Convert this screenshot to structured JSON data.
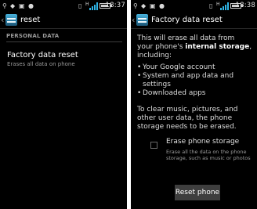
{
  "left": {
    "status": {
      "time": "18:37",
      "signal_label": "H"
    },
    "actionbar": {
      "title": "reset"
    },
    "section_header": "PERSONAL DATA",
    "item": {
      "title": "Factory data reset",
      "subtitle": "Erases all data on phone"
    }
  },
  "right": {
    "status": {
      "time": "18:38",
      "signal_label": "H"
    },
    "actionbar": {
      "title": "Factory data reset"
    },
    "intro_before": "This will erase all data from your phone's ",
    "intro_bold": "internal storage",
    "intro_after": ", including:",
    "bullets": [
      "Your Google account",
      "System and app data and settings",
      "Downloaded apps"
    ],
    "clear_text": "To clear music, pictures, and other user data, the phone storage needs to be erased.",
    "erase_option": {
      "label": "Erase phone storage",
      "description": "Erase all the data on the phone storage, such as music or photos",
      "checked": false
    },
    "reset_button": "Reset phone"
  },
  "colors": {
    "background": "#000000",
    "accent": "#2fb5e6",
    "secondary_text": "#9a9a9a"
  },
  "icons": [
    "usb-icon",
    "wifi-icon",
    "notification-icon",
    "messaging-icon",
    "sim-icon",
    "signal-icon",
    "battery-icon",
    "settings-app-icon",
    "back-chevron-icon"
  ]
}
